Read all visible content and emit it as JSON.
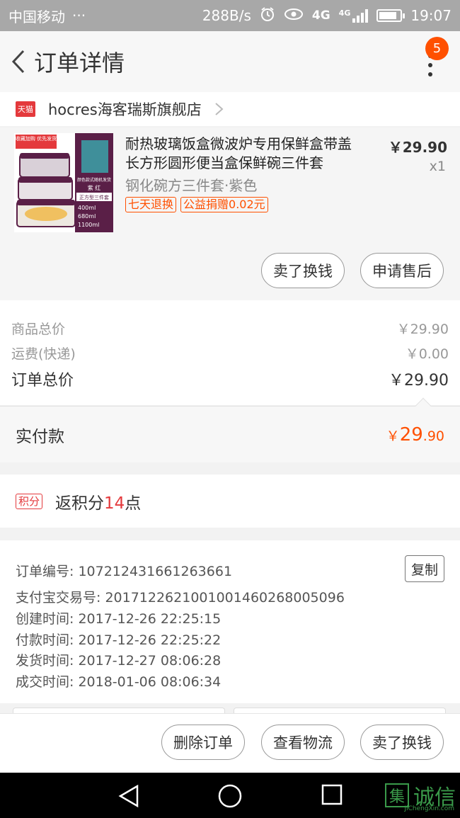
{
  "status_bar": {
    "carrier": "中国移动",
    "dots": "···",
    "speed": "288B/s",
    "network": "4G",
    "network2": "4G",
    "time": "19:07"
  },
  "header": {
    "title": "订单详情",
    "badge_count": "5"
  },
  "shop": {
    "tag": "天猫",
    "name": "hocres海客瑞斯旗舰店"
  },
  "item": {
    "title": "耐热玻璃饭盒微波炉专用保鲜盒带盖长方形圆形便当盒保鲜碗三件套",
    "sku": "钢化碗方三件套·紫色",
    "tags": [
      "七天退换",
      "公益捐赠0.02元"
    ],
    "price": "￥29.90",
    "qty": "x1",
    "thumb_texts": {
      "badge": "收藏加购 优先发货",
      "side": "颜色款式随机发货",
      "color": "紫 红",
      "set": "正方型三件套",
      "sizes": [
        "400ml",
        "680ml",
        "1100ml"
      ]
    },
    "btn_sell": "卖了换钱",
    "btn_aftersale": "申请售后"
  },
  "totals": {
    "goods_label": "商品总价",
    "goods_value": "￥29.90",
    "shipping_label": "运费(快递)",
    "shipping_value": "￥0.00",
    "order_label": "订单总价",
    "order_value": "￥29.90"
  },
  "paid": {
    "label": "实付款",
    "currency": "￥",
    "integer": "29",
    "decimal": ".90"
  },
  "points": {
    "tag": "积分",
    "prefix": "返积分",
    "number": "14",
    "suffix": "点"
  },
  "order_info": {
    "copy_label": "复制",
    "rows": [
      "订单编号: 107212431661263661",
      "支付宝交易号: 2017122621001001460268005096",
      "创建时间: 2017-12-26 22:25:15",
      "付款时间: 2017-12-26 22:25:22",
      "发货时间: 2017-12-27 08:06:28",
      "成交时间: 2018-01-06 08:06:34"
    ]
  },
  "actions": {
    "delete": "删除订单",
    "logistics": "查看物流",
    "sell": "卖了换钱"
  },
  "watermark": {
    "logo": "集",
    "text": "诚信",
    "sub": "JiChengXin.com"
  },
  "colors": {
    "accent": "#ff5000",
    "tmall_red": "#e4393c",
    "watermark_green": "#3a9a4a"
  }
}
